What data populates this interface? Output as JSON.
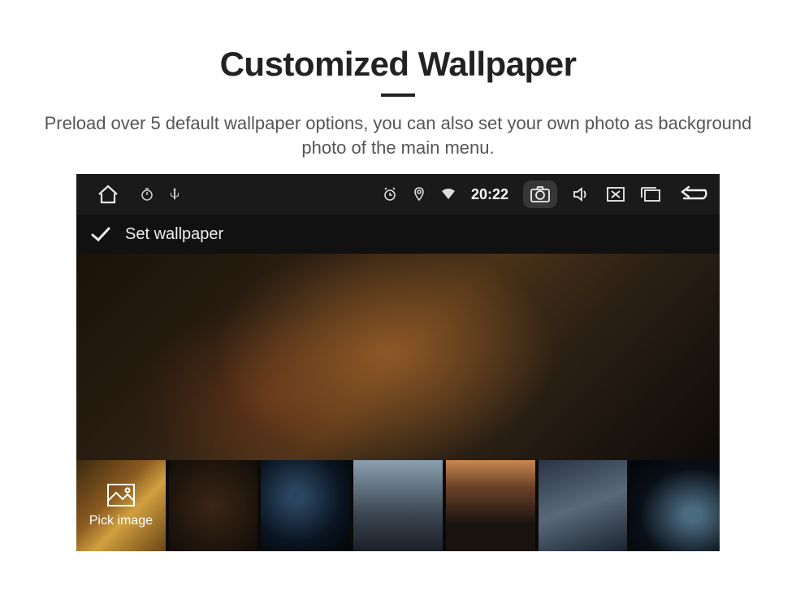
{
  "page": {
    "title": "Customized Wallpaper",
    "subtitle": "Preload over 5 default wallpaper options, you can also set your own photo as background photo of the main menu."
  },
  "statusbar": {
    "clock": "20:22"
  },
  "titlebar": {
    "label": "Set wallpaper"
  },
  "thumbs": {
    "pick_label": "Pick image"
  }
}
